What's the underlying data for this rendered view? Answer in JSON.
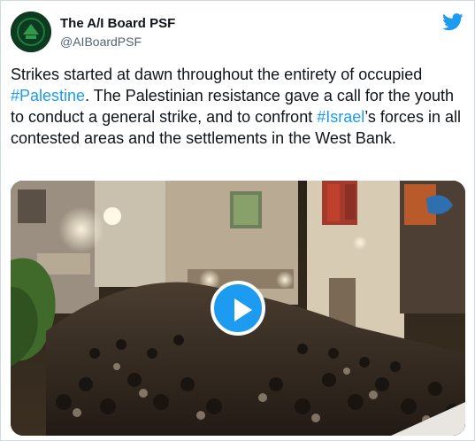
{
  "tweet": {
    "author_name": "The A/I Board PSF",
    "author_handle": "@AIBoardPSF",
    "text_segments": [
      {
        "text": "Strikes started at dawn throughout the entirety of occupied ",
        "hashtag": false
      },
      {
        "text": "#Palestine",
        "hashtag": true
      },
      {
        "text": ". The Palestinian resistance gave a call for the youth to conduct a general strike, and to confront ",
        "hashtag": false
      },
      {
        "text": "#Israel",
        "hashtag": true
      },
      {
        "text": "’s forces in all contested areas and the settlements in the West Bank.",
        "hashtag": false
      }
    ]
  },
  "icons": {
    "platform": "twitter-bird-icon",
    "media_control": "play-icon"
  },
  "colors": {
    "accent": "#1d9bf0",
    "text": "#0f1419",
    "secondary_text": "#536471"
  }
}
